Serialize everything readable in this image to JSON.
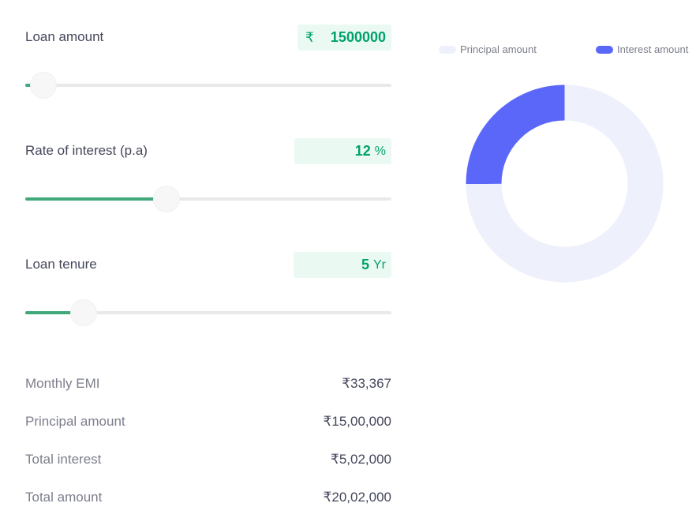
{
  "inputs": {
    "loan_amount": {
      "label": "Loan amount",
      "prefix": "₹",
      "value": "1500000",
      "slider_fraction": 0.05
    },
    "interest_rate": {
      "label": "Rate of interest (p.a)",
      "value": "12",
      "suffix": "%",
      "slider_fraction": 0.385
    },
    "loan_tenure": {
      "label": "Loan tenure",
      "value": "5",
      "suffix": "Yr",
      "slider_fraction": 0.16
    }
  },
  "summary": {
    "monthly_emi": {
      "label": "Monthly EMI",
      "value": "₹33,367"
    },
    "principal": {
      "label": "Principal amount",
      "value": "₹15,00,000"
    },
    "total_interest": {
      "label": "Total interest",
      "value": "₹5,02,000"
    },
    "total_amount": {
      "label": "Total amount",
      "value": "₹20,02,000"
    }
  },
  "chart_data": {
    "type": "pie",
    "legend_placement": "top",
    "series": [
      {
        "name": "Principal amount",
        "value": 1500000,
        "color": "#eef0fb"
      },
      {
        "name": "Interest amount",
        "value": 502000,
        "color": "#5b67f8"
      }
    ]
  },
  "colors": {
    "accent_green": "#00a26b",
    "slider_green": "#41a87c",
    "value_box_bg": "#ebf9f3"
  }
}
